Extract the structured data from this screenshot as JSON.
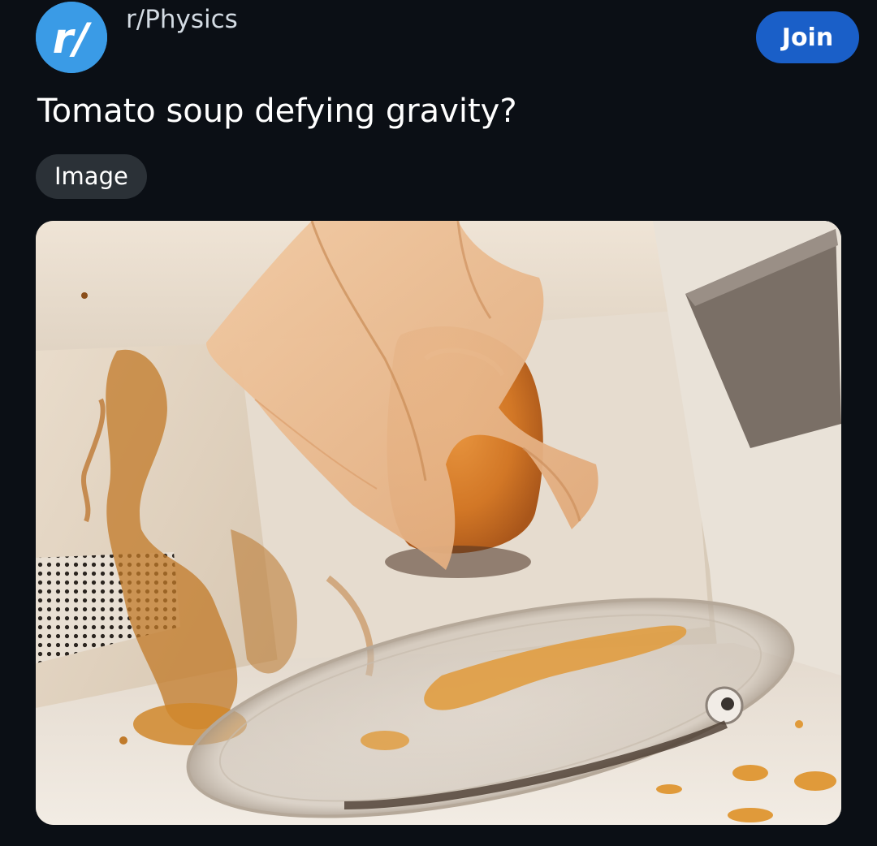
{
  "subreddit": {
    "name": "r/Physics",
    "avatar_icon": "reddit-subreddit-icon",
    "avatar_color": "#3a9be6",
    "join_label": "Join",
    "join_color": "#1a5fc8"
  },
  "post": {
    "title": "Tomato soup defying gravity?",
    "flair": "Image",
    "media_alt": "Inside of a microwave splattered with tomato soup; a container wrapped in a paper towel is stuck to the ceiling"
  },
  "colors": {
    "background": "#0b0f15",
    "flair_background": "#2b3137"
  }
}
